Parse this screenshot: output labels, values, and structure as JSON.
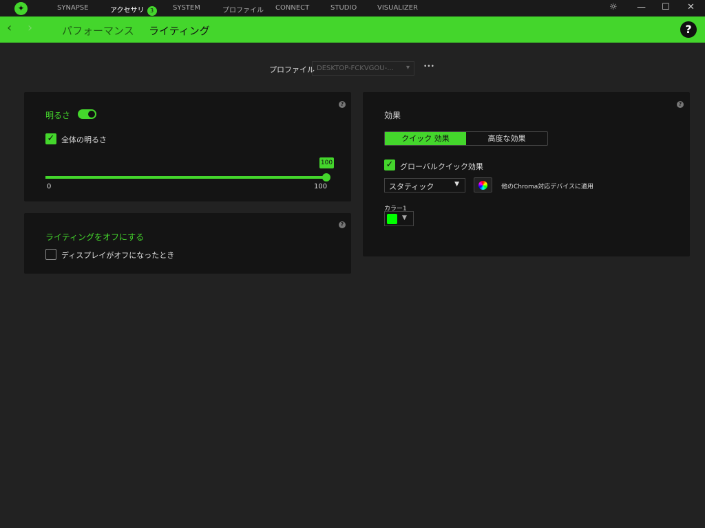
{
  "titlebar": {
    "nav": [
      "SYNAPSE",
      "アクセサリ",
      "SYSTEM",
      "プロファイル",
      "CONNECT",
      "STUDIO",
      "VISUALIZER"
    ],
    "badge": "3"
  },
  "breadcrumb": [
    "パフォーマンス",
    "ライティング"
  ],
  "profile": {
    "label": "プロファイル",
    "value": "DESKTOP-FCKVGOU-...",
    "more": "•••"
  },
  "brightness": {
    "title": "明るさ",
    "toggle_on": true,
    "overall_label": "全体の明るさ",
    "value": 100,
    "tooltip": "100",
    "min": "0",
    "max": "100"
  },
  "lights_off": {
    "title": "ライティングをオフにする",
    "checkbox_label": "ディスプレイがオフになったとき"
  },
  "effects": {
    "title": "効果",
    "tabs": [
      "クイック 効果",
      "高度な効果"
    ],
    "global_label": "グローバルクイック効果",
    "effect_select": "スタティック",
    "apply_label": "他のChroma対応デバイスに適用",
    "color_label": "カラー1",
    "color": "#00ff00"
  },
  "colors": {
    "accent": "#44d62c"
  }
}
